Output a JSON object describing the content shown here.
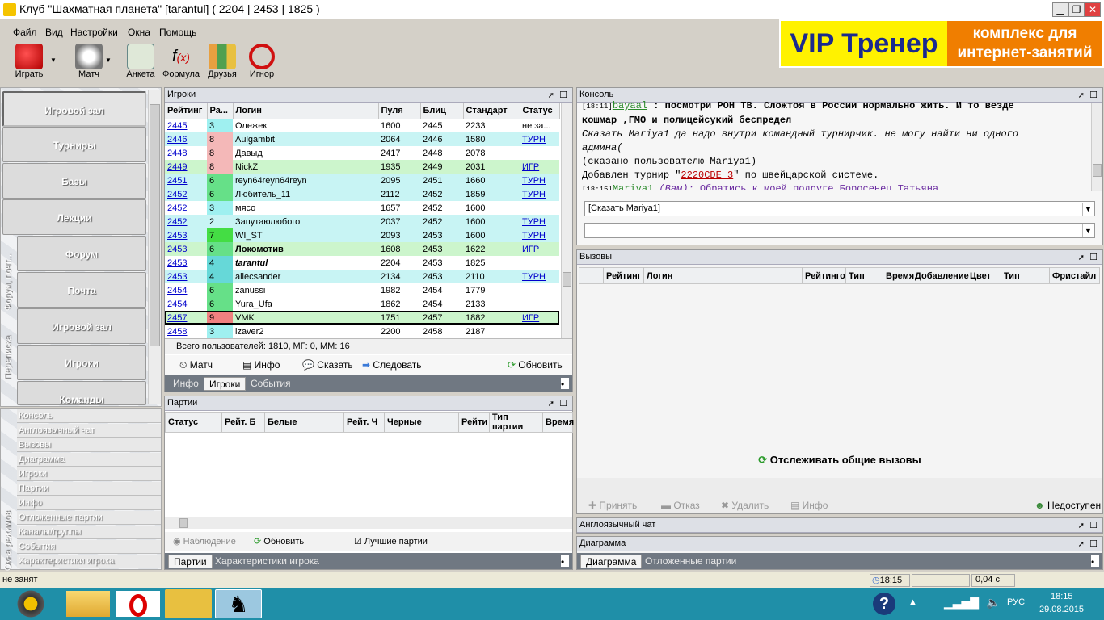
{
  "window": {
    "title": "Клуб \"Шахматная планета\" [tarantul]   ( 2204 | 2453 | 1825 )"
  },
  "menu": [
    "Файл",
    "Вид",
    "Настройки",
    "Окна",
    "Помощь"
  ],
  "toolbar": [
    {
      "label": "Играть",
      "icon": "dice-icon"
    },
    {
      "label": "Матч",
      "icon": "chess-clock-icon"
    },
    {
      "label": "Анкета",
      "icon": "profile-icon"
    },
    {
      "label": "Формула",
      "icon": "formula-icon"
    },
    {
      "label": "Друзья",
      "icon": "friends-icon"
    },
    {
      "label": "Игнор",
      "icon": "ignore-icon"
    }
  ],
  "banner": {
    "left": "VIP Тренер",
    "right": "комплекс для интернет-занятий"
  },
  "nav": {
    "main": [
      "Игровой зал",
      "Турниры",
      "Базы",
      "Лекции"
    ],
    "forum_group_label": "Форум, почт...",
    "forum": [
      "Форум",
      "Почта"
    ],
    "messaging_group_label": "Переписка",
    "messaging": [
      "Игровой зал",
      "Игроки",
      "Команды"
    ]
  },
  "modes": {
    "group_label": "Окна режимов",
    "items": [
      "Консоль",
      "Англоязычный чат",
      "Вызовы",
      "Диаграмма",
      "Игроки",
      "Партии",
      "Инфо",
      "Отложенные партии",
      "Каналы/группы",
      "События",
      "Характеристики игрока"
    ]
  },
  "players": {
    "title": "Игроки",
    "columns": [
      "Рейтинг",
      "Ра...",
      "Логин",
      "Пуля",
      "Блиц",
      "Стандарт",
      "Статус"
    ],
    "rows": [
      {
        "rating": "2445",
        "rank": "3",
        "login": "Олежек",
        "bullet": "1600",
        "blitz": "2445",
        "standard": "2233",
        "status": "не за...",
        "bg": "#ffffff",
        "rankbg": "#9ff0f0"
      },
      {
        "rating": "2446",
        "rank": "8",
        "login": "Aulgambit",
        "bullet": "2064",
        "blitz": "2446",
        "standard": "1580",
        "status": "ТУРН",
        "bg": "#c8f4f4",
        "rankbg": "#f4b8b8"
      },
      {
        "rating": "2448",
        "rank": "8",
        "login": "Давыд",
        "bullet": "2417",
        "blitz": "2448",
        "standard": "2078",
        "status": "",
        "bg": "#ffffff",
        "rankbg": "#f4b8b8"
      },
      {
        "rating": "2449",
        "rank": "8",
        "login": "NickZ",
        "bullet": "1935",
        "blitz": "2449",
        "standard": "2031",
        "status": "ИГР",
        "bg": "#ccf5cc",
        "rankbg": "#f4b8b8"
      },
      {
        "rating": "2451",
        "rank": "6",
        "login": "reyn64reyn64reyn",
        "bullet": "2095",
        "blitz": "2451",
        "standard": "1660",
        "status": "ТУРН",
        "bg": "#c8f4f4",
        "rankbg": "#66e088"
      },
      {
        "rating": "2452",
        "rank": "6",
        "login": "Любитель_11",
        "bullet": "2112",
        "blitz": "2452",
        "standard": "1859",
        "status": "ТУРН",
        "bg": "#c8f4f4",
        "rankbg": "#66e088"
      },
      {
        "rating": "2452",
        "rank": "3",
        "login": "мясо",
        "bullet": "1657",
        "blitz": "2452",
        "standard": "1600",
        "status": "",
        "bg": "#ffffff",
        "rankbg": "#9ff0f0"
      },
      {
        "rating": "2452",
        "rank": "2",
        "login": "Запутаюлюбого",
        "bullet": "2037",
        "blitz": "2452",
        "standard": "1600",
        "status": "ТУРН",
        "bg": "#c8f4f4",
        "rankbg": "#c8f4f4"
      },
      {
        "rating": "2453",
        "rank": "7",
        "login": "WI_ST",
        "bullet": "2093",
        "blitz": "2453",
        "standard": "1600",
        "status": "ТУРН",
        "bg": "#c8f4f4",
        "rankbg": "#44dd44"
      },
      {
        "rating": "2453",
        "rank": "6",
        "login": "Локомотив",
        "bullet": "1608",
        "blitz": "2453",
        "standard": "1622",
        "status": "ИГР",
        "bg": "#ccf5cc",
        "rankbg": "#66e088",
        "bold": true
      },
      {
        "rating": "2453",
        "rank": "4",
        "login": "tarantul",
        "bullet": "2204",
        "blitz": "2453",
        "standard": "1825",
        "status": "",
        "bg": "#ffffff",
        "rankbg": "#66d8d8",
        "bold": true,
        "italic": true
      },
      {
        "rating": "2453",
        "rank": "4",
        "login": "allecsander",
        "bullet": "2134",
        "blitz": "2453",
        "standard": "2110",
        "status": "ТУРН",
        "bg": "#c8f4f4",
        "rankbg": "#66d8d8"
      },
      {
        "rating": "2454",
        "rank": "6",
        "login": "zanussi",
        "bullet": "1982",
        "blitz": "2454",
        "standard": "1779",
        "status": "",
        "bg": "#ffffff",
        "rankbg": "#66e088"
      },
      {
        "rating": "2454",
        "rank": "6",
        "login": "Yura_Ufa",
        "bullet": "1862",
        "blitz": "2454",
        "standard": "2133",
        "status": "",
        "bg": "#ffffff",
        "rankbg": "#66e088"
      },
      {
        "rating": "2457",
        "rank": "9",
        "login": "VMK",
        "bullet": "1751",
        "blitz": "2457",
        "standard": "1882",
        "status": "ИГР",
        "bg": "#ccf5cc",
        "rankbg": "#f08080",
        "selected": true
      },
      {
        "rating": "2458",
        "rank": "3",
        "login": "izaver2",
        "bullet": "2200",
        "blitz": "2458",
        "standard": "2187",
        "status": "",
        "bg": "#ffffff",
        "rankbg": "#9ff0f0"
      }
    ],
    "summary": "Всего пользователей: 1810, МГ: 0, ММ: 16",
    "actions": [
      "Матч",
      "Инфо",
      "Сказать",
      "Следовать",
      "Обновить"
    ],
    "tabs": [
      "Инфо",
      "Игроки",
      "События"
    ]
  },
  "games": {
    "title": "Партии",
    "columns": [
      "Статус",
      "Рейт. Б",
      "Белые",
      "Рейт. Ч",
      "Черные",
      "Рейти",
      "Тип партии",
      "Время"
    ],
    "observe": "Наблюдение",
    "refresh": "Обновить",
    "best_games": "Лучшие партии",
    "tabs": [
      "Партии",
      "Характеристики игрока"
    ]
  },
  "console": {
    "title": "Консоль",
    "lines": [
      {
        "prefix": "[18:11]",
        "name": "bayaal",
        "text": " : посмотри РОН ТВ. Сложтоя в России нормально жить. И то везде"
      },
      {
        "text": "кошмар  ,ГМО и полицейсукий беспредел"
      },
      {
        "text": "Сказать Mariya1 да надо внутри командный турнирчик. не могу найти ни одного"
      },
      {
        "text": "админа("
      },
      {
        "text": "(сказано пользователю Mariya1)"
      },
      {
        "text": "Добавлен турнир \"",
        "link": "2220CDE 3",
        "after": "\" по швейцарской системе."
      },
      {
        "prefix": "[18:15]",
        "name": "Mariya1",
        "whisper": " (Вам):",
        "text": " Обратись к моей подруге Боросенец_Татьяна"
      }
    ],
    "say_value": "[Сказать Mariya1]",
    "cmd_value": ""
  },
  "challenges": {
    "title": "Вызовы",
    "columns": [
      "Рейтинг",
      "Логин",
      "Рейтинго",
      "Тип",
      "Время",
      "Добавление",
      "Цвет",
      "Тип",
      "Фристайл"
    ],
    "track_button": "Отслеживать общие вызовы",
    "actions": [
      "Принять",
      "Отказ",
      "Удалить",
      "Инфо"
    ],
    "availability": "Недоступен"
  },
  "eng_chat": {
    "title": "Англоязычный чат"
  },
  "diagram": {
    "title": "Диаграмма",
    "tabs": [
      "Диаграмма",
      "Отложенные партии"
    ]
  },
  "status": {
    "left": "не занят",
    "time": "18:15",
    "lag": "0,04 с"
  },
  "taskbar": {
    "lang": "РУС",
    "clock": "18:15",
    "date": "29.08.2015"
  }
}
